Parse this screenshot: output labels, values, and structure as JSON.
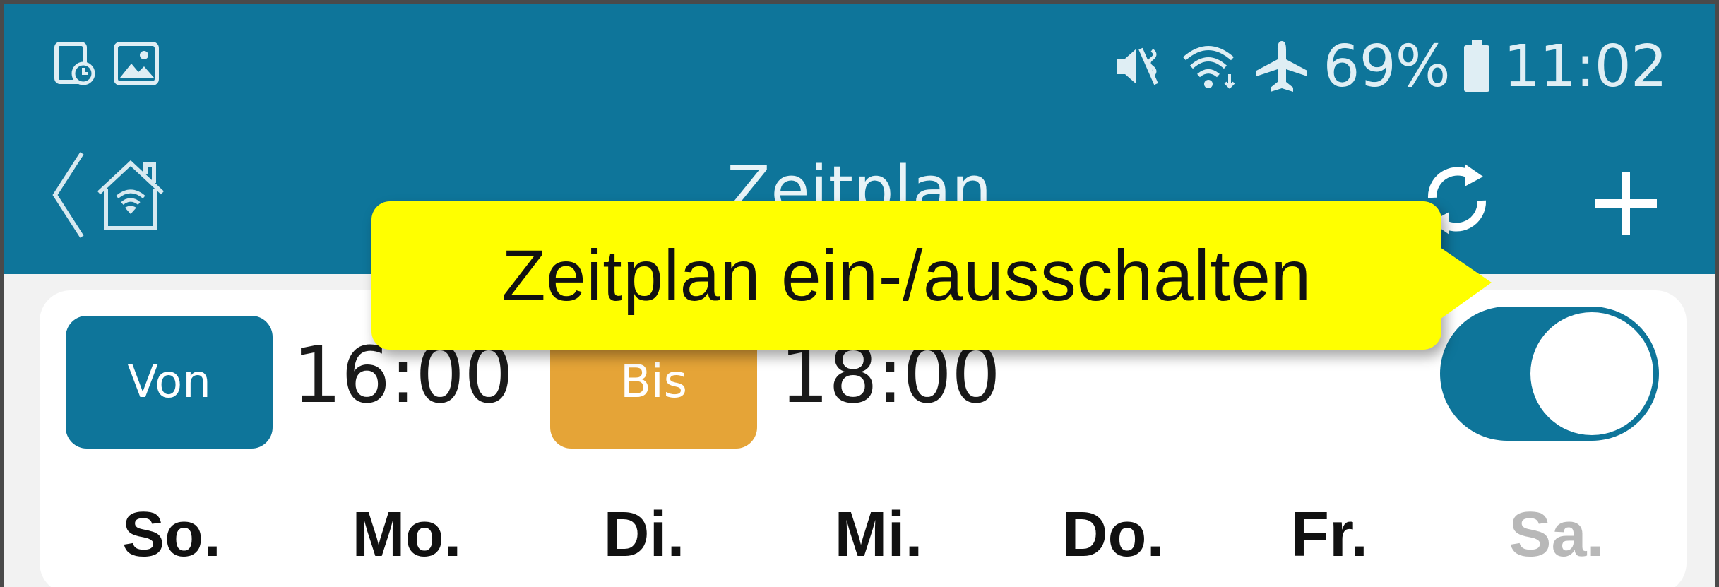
{
  "status_bar": {
    "battery_percent": "69%",
    "time": "11:02",
    "icons": [
      "screenshot-icon",
      "gallery-icon",
      "vibrate-mute-icon",
      "wifi-icon",
      "airplane-icon",
      "battery-icon"
    ]
  },
  "header": {
    "title": "Zeitplan",
    "icons": [
      "back-chevron-icon",
      "smart-home-icon",
      "sync-icon",
      "add-icon"
    ]
  },
  "schedule": {
    "from_label": "Von",
    "from_time": "16:00",
    "to_label": "Bis",
    "to_time": "18:00",
    "enabled": true,
    "days": [
      {
        "label": "So.",
        "active": true
      },
      {
        "label": "Mo.",
        "active": true
      },
      {
        "label": "Di.",
        "active": true
      },
      {
        "label": "Mi.",
        "active": true
      },
      {
        "label": "Do.",
        "active": true
      },
      {
        "label": "Fr.",
        "active": true
      },
      {
        "label": "Sa.",
        "active": false
      }
    ]
  },
  "callout": {
    "text": "Zeitplan ein-/ausschalten"
  },
  "colors": {
    "primary": "#0e759a",
    "accent": "#e5a437",
    "callout": "#ffff00",
    "inactive_day": "#b8b8b8"
  }
}
